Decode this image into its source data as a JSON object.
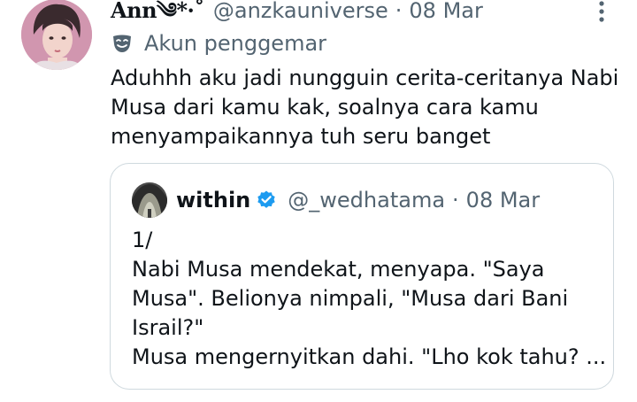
{
  "tweet": {
    "display_name": "Ann༄*·˚",
    "handle": "@anzkauniverse",
    "separator": "·",
    "date": "08 Mar",
    "fan_label": "Akun penggemar",
    "text": "Aduhhh aku jadi nungguin cerita-ceritanya Nabi Musa dari kamu kak, soalnya cara kamu menyampaikannya tuh seru banget",
    "avatar_icon": "avatar-photo",
    "more_icon": "more-vertical-icon",
    "fan_icon": "mask-icon"
  },
  "quote": {
    "display_name": "within",
    "verified_icon": "verified-badge-icon",
    "handle": "@_wedhatama",
    "separator": "·",
    "date": "08 Mar",
    "lines": [
      "1/",
      "Nabi Musa mendekat, menyapa. \"Saya",
      "Musa\". Belionya nimpali, \"Musa dari Bani",
      "Israil?\"",
      "Musa mengernyitkan dahi. \"Lho kok tahu? ..."
    ]
  },
  "colors": {
    "text_primary": "#0f1419",
    "text_secondary": "#536471",
    "border": "#cfd9de",
    "verified_blue": "#1d9bf0"
  }
}
